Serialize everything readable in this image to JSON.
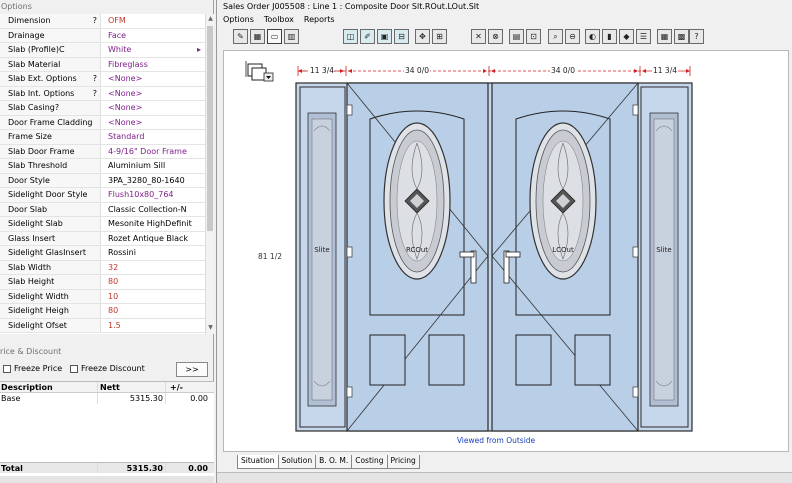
{
  "left_panel": {
    "options_title": "Options",
    "properties": [
      {
        "label": "Dimension",
        "marker": "?",
        "value": "OFM",
        "style": "red",
        "extra": ""
      },
      {
        "label": "Drainage",
        "marker": "",
        "value": "Face",
        "style": "purple",
        "extra": ""
      },
      {
        "label": "Slab (Profile)C",
        "marker": "",
        "value": "White",
        "style": "purple",
        "extra": "▸"
      },
      {
        "label": "Slab Material",
        "marker": "",
        "value": "Fibreglass",
        "style": "purple",
        "extra": ""
      },
      {
        "label": "Slab Ext. Options",
        "marker": "?",
        "value": "<None>",
        "style": "purple",
        "extra": ""
      },
      {
        "label": "Slab Int. Options",
        "marker": "?",
        "value": "<None>",
        "style": "purple",
        "extra": ""
      },
      {
        "label": "Slab Casing?",
        "marker": "",
        "value": "<None>",
        "style": "purple",
        "extra": ""
      },
      {
        "label": "Door Frame Cladding",
        "marker": "",
        "value": "<None>",
        "style": "purple",
        "extra": ""
      },
      {
        "label": "Frame Size",
        "marker": "",
        "value": "Standard",
        "style": "purple",
        "extra": ""
      },
      {
        "label": "Slab Door Frame",
        "marker": "",
        "value": "4-9/16\" Door Frame",
        "style": "purple",
        "extra": ""
      },
      {
        "label": "Slab Threshold",
        "marker": "",
        "value": "Aluminium Sill",
        "style": "plain",
        "extra": ""
      },
      {
        "label": "Door Style",
        "marker": "",
        "value": "3PA_3280_80-1640",
        "style": "plain",
        "extra": ""
      },
      {
        "label": "Sidelight Door Style",
        "marker": "",
        "value": "Flush10x80_764",
        "style": "purple",
        "extra": ""
      },
      {
        "label": "Door Slab",
        "marker": "",
        "value": "Classic Collection-N",
        "style": "plain",
        "extra": ""
      },
      {
        "label": "Sidelight Slab",
        "marker": "",
        "value": "Mesonite HighDefinit",
        "style": "plain",
        "extra": ""
      },
      {
        "label": "Glass Insert",
        "marker": "",
        "value": "Rozet Antique Black",
        "style": "plain",
        "extra": ""
      },
      {
        "label": "Sidelight GlasInsert",
        "marker": "",
        "value": "Rossini",
        "style": "plain",
        "extra": ""
      },
      {
        "label": "Slab Width",
        "marker": "",
        "value": "32",
        "style": "red",
        "extra": ""
      },
      {
        "label": "Slab Height",
        "marker": "",
        "value": "80",
        "style": "red",
        "extra": ""
      },
      {
        "label": "Sidelight Width",
        "marker": "",
        "value": "10",
        "style": "red",
        "extra": ""
      },
      {
        "label": "Sidelight Heigh",
        "marker": "",
        "value": "80",
        "style": "red",
        "extra": ""
      },
      {
        "label": "Sidelight Ofset",
        "marker": "",
        "value": "1.5",
        "style": "red",
        "extra": ""
      }
    ],
    "price_section": {
      "title": "rice & Discount",
      "freeze_price": "Freeze Price",
      "freeze_discount": "Freeze Discount",
      "more_button": ">>",
      "headers": {
        "description": "Description",
        "nett": "Nett",
        "plusminus": "+/-"
      },
      "rows": [
        {
          "description": "Base",
          "nett": "5315.30",
          "plusminus": "0.00"
        }
      ],
      "total": {
        "label": "Total",
        "nett": "5315.30",
        "plusminus": "0.00"
      }
    }
  },
  "right_panel": {
    "title": "Sales Order J005508  : Line   1 : Composite Door Slt.ROut.LOut.Slt",
    "menu": [
      "Options",
      "Toolbox",
      "Reports"
    ],
    "toolbar_icons": [
      "edit-icon",
      "grid-icon",
      "frame-icon",
      "layout-icon",
      "teal-door-icon",
      "teal-pen-icon",
      "teal-frame-icon",
      "teal-split-icon",
      "move-icon",
      "align-icon",
      "cross-icon",
      "link-icon",
      "table-icon",
      "sash-icon",
      "zoom-icon",
      "zoom-out-icon",
      "palette-icon",
      "mullion-icon",
      "swatch-icon",
      "list-icon",
      "grid2-icon",
      "picture-icon",
      "help-icon"
    ],
    "drawing": {
      "dim_sidelight_left": "11 3/4",
      "dim_door_left": "34 0/0",
      "dim_door_right": "34 0/0",
      "dim_sidelight_right": "11 3/4",
      "dim_height": "81 1/2",
      "panel_left_label": "Slite",
      "door_left_label": "RCOut",
      "door_right_label": "LCOut",
      "panel_right_label": "Slite",
      "caption": "Viewed from Outside",
      "door_fill": "#b9cfe8",
      "frame_fill": "#c6d7ec",
      "dim_color": "#d02020",
      "caption_color": "#1a3fb8"
    },
    "tabs": [
      "Situation",
      "Solution",
      "B. O. M.",
      "Costing",
      "Pricing"
    ]
  }
}
